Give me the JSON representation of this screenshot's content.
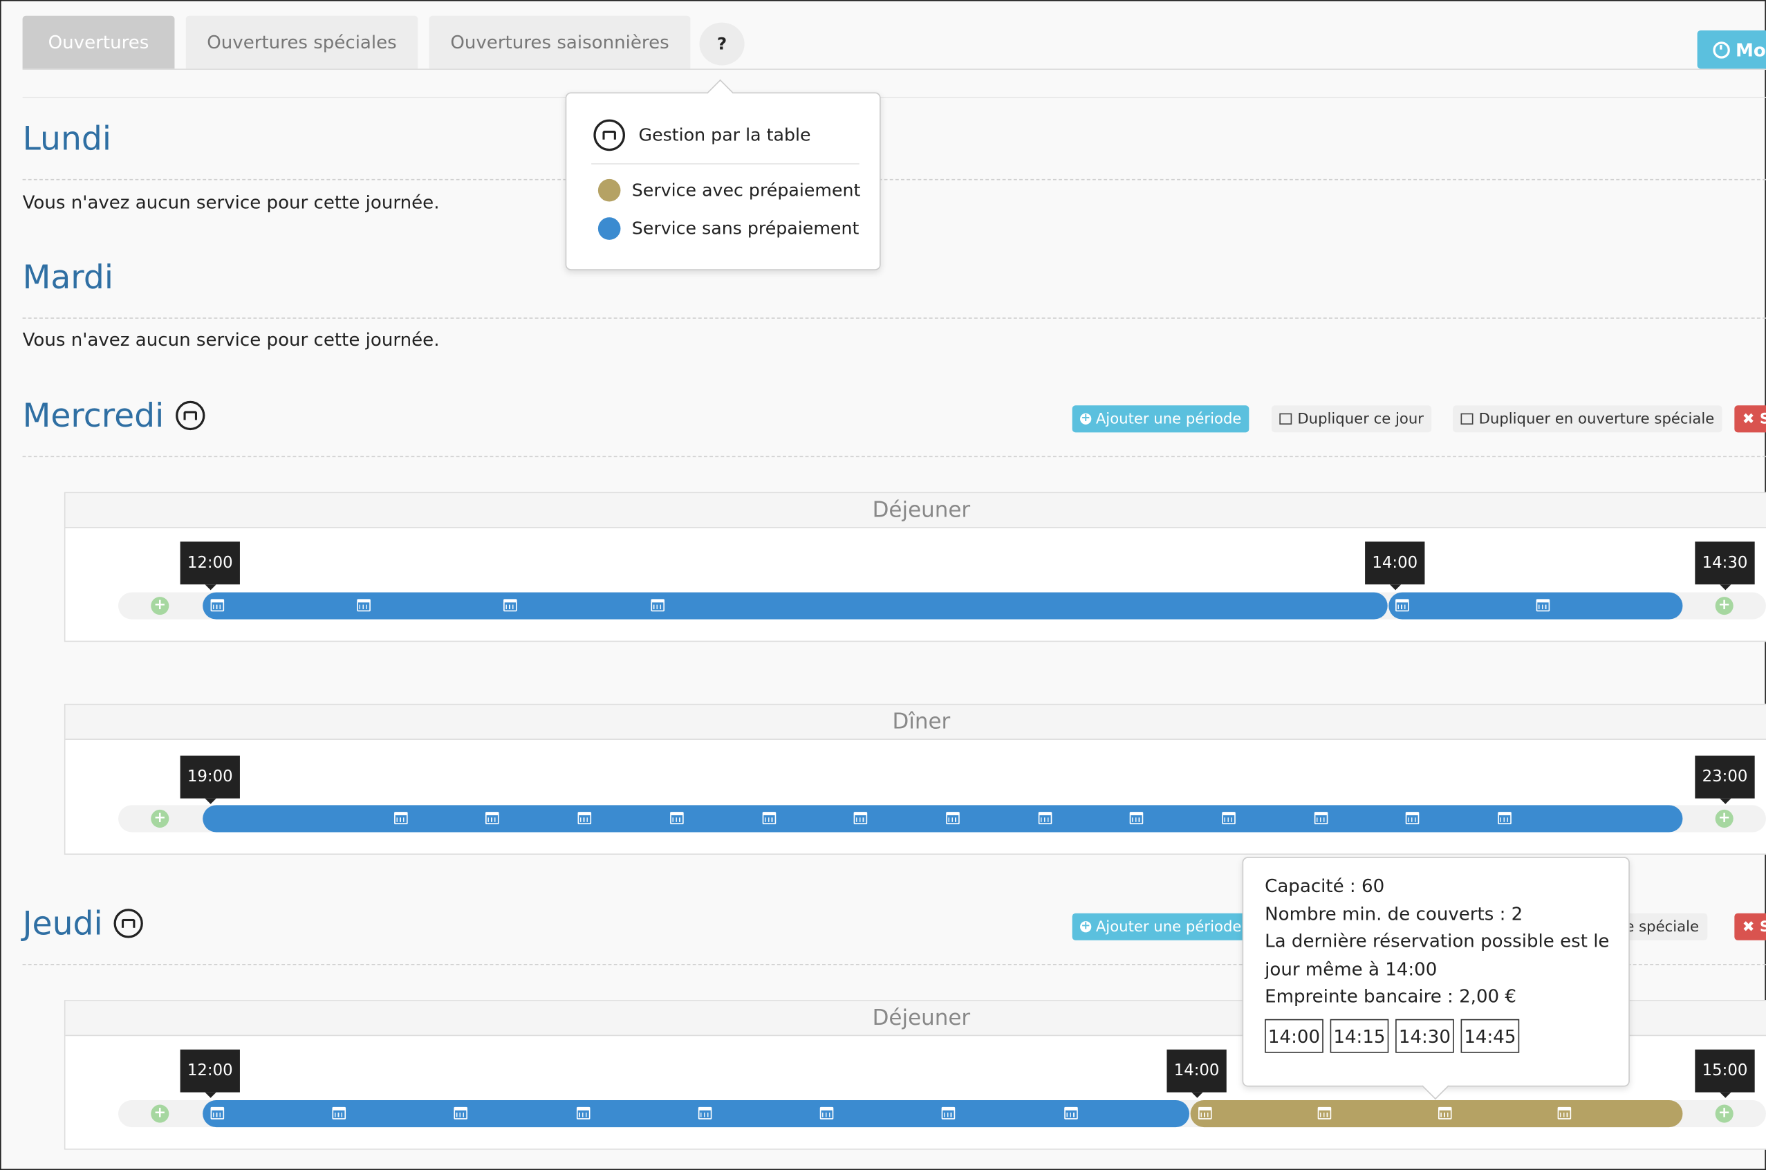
{
  "tabs": [
    {
      "label": "Ouvertures",
      "active": true
    },
    {
      "label": "Ouvertures spéciales",
      "active": false
    },
    {
      "label": "Ouvertures saisonnières",
      "active": false
    }
  ],
  "help_label": "?",
  "top_button_label": "Mo",
  "legend": {
    "table_label": "Gestion par la table",
    "prepaid_label": "Service avec prépaiement",
    "prepaid_color": "#b5a264",
    "noprepaid_label": "Service sans prépaiement",
    "noprepaid_color": "#3b8bd0"
  },
  "days": {
    "lundi": {
      "title": "Lundi",
      "empty": "Vous n'avez aucun service pour cette journée."
    },
    "mardi": {
      "title": "Mardi",
      "empty": "Vous n'avez aucun service pour cette journée."
    },
    "mercredi": {
      "title": "Mercredi"
    },
    "jeudi": {
      "title": "Jeudi"
    }
  },
  "actions": {
    "add_period": "Ajouter une période",
    "duplicate_day": "Dupliquer ce jour",
    "duplicate_special": "Dupliquer en ouverture spéciale",
    "duplicate_special_partial": "e spéciale",
    "delete_partial": "S",
    "delete_mark": "✖"
  },
  "services": {
    "mer_dej": {
      "title": "Déjeuner",
      "t1": "12:00",
      "t2": "14:00",
      "t3": "14:30"
    },
    "mer_din": {
      "title": "Dîner",
      "t1": "19:00",
      "t3": "23:00"
    },
    "jeu_dej": {
      "title": "Déjeuner",
      "t1": "12:00",
      "t2": "14:00",
      "t3": "15:00"
    }
  },
  "tooltip": {
    "capacity": "Capacité : 60",
    "min_covers": "Nombre min. de couverts : 2",
    "last_booking_1": "La dernière réservation possible est le",
    "last_booking_2": "jour même à 14:00",
    "deposit": "Empreinte bancaire : 2,00 €",
    "slots": [
      "14:00",
      "14:15",
      "14:30",
      "14:45"
    ]
  }
}
